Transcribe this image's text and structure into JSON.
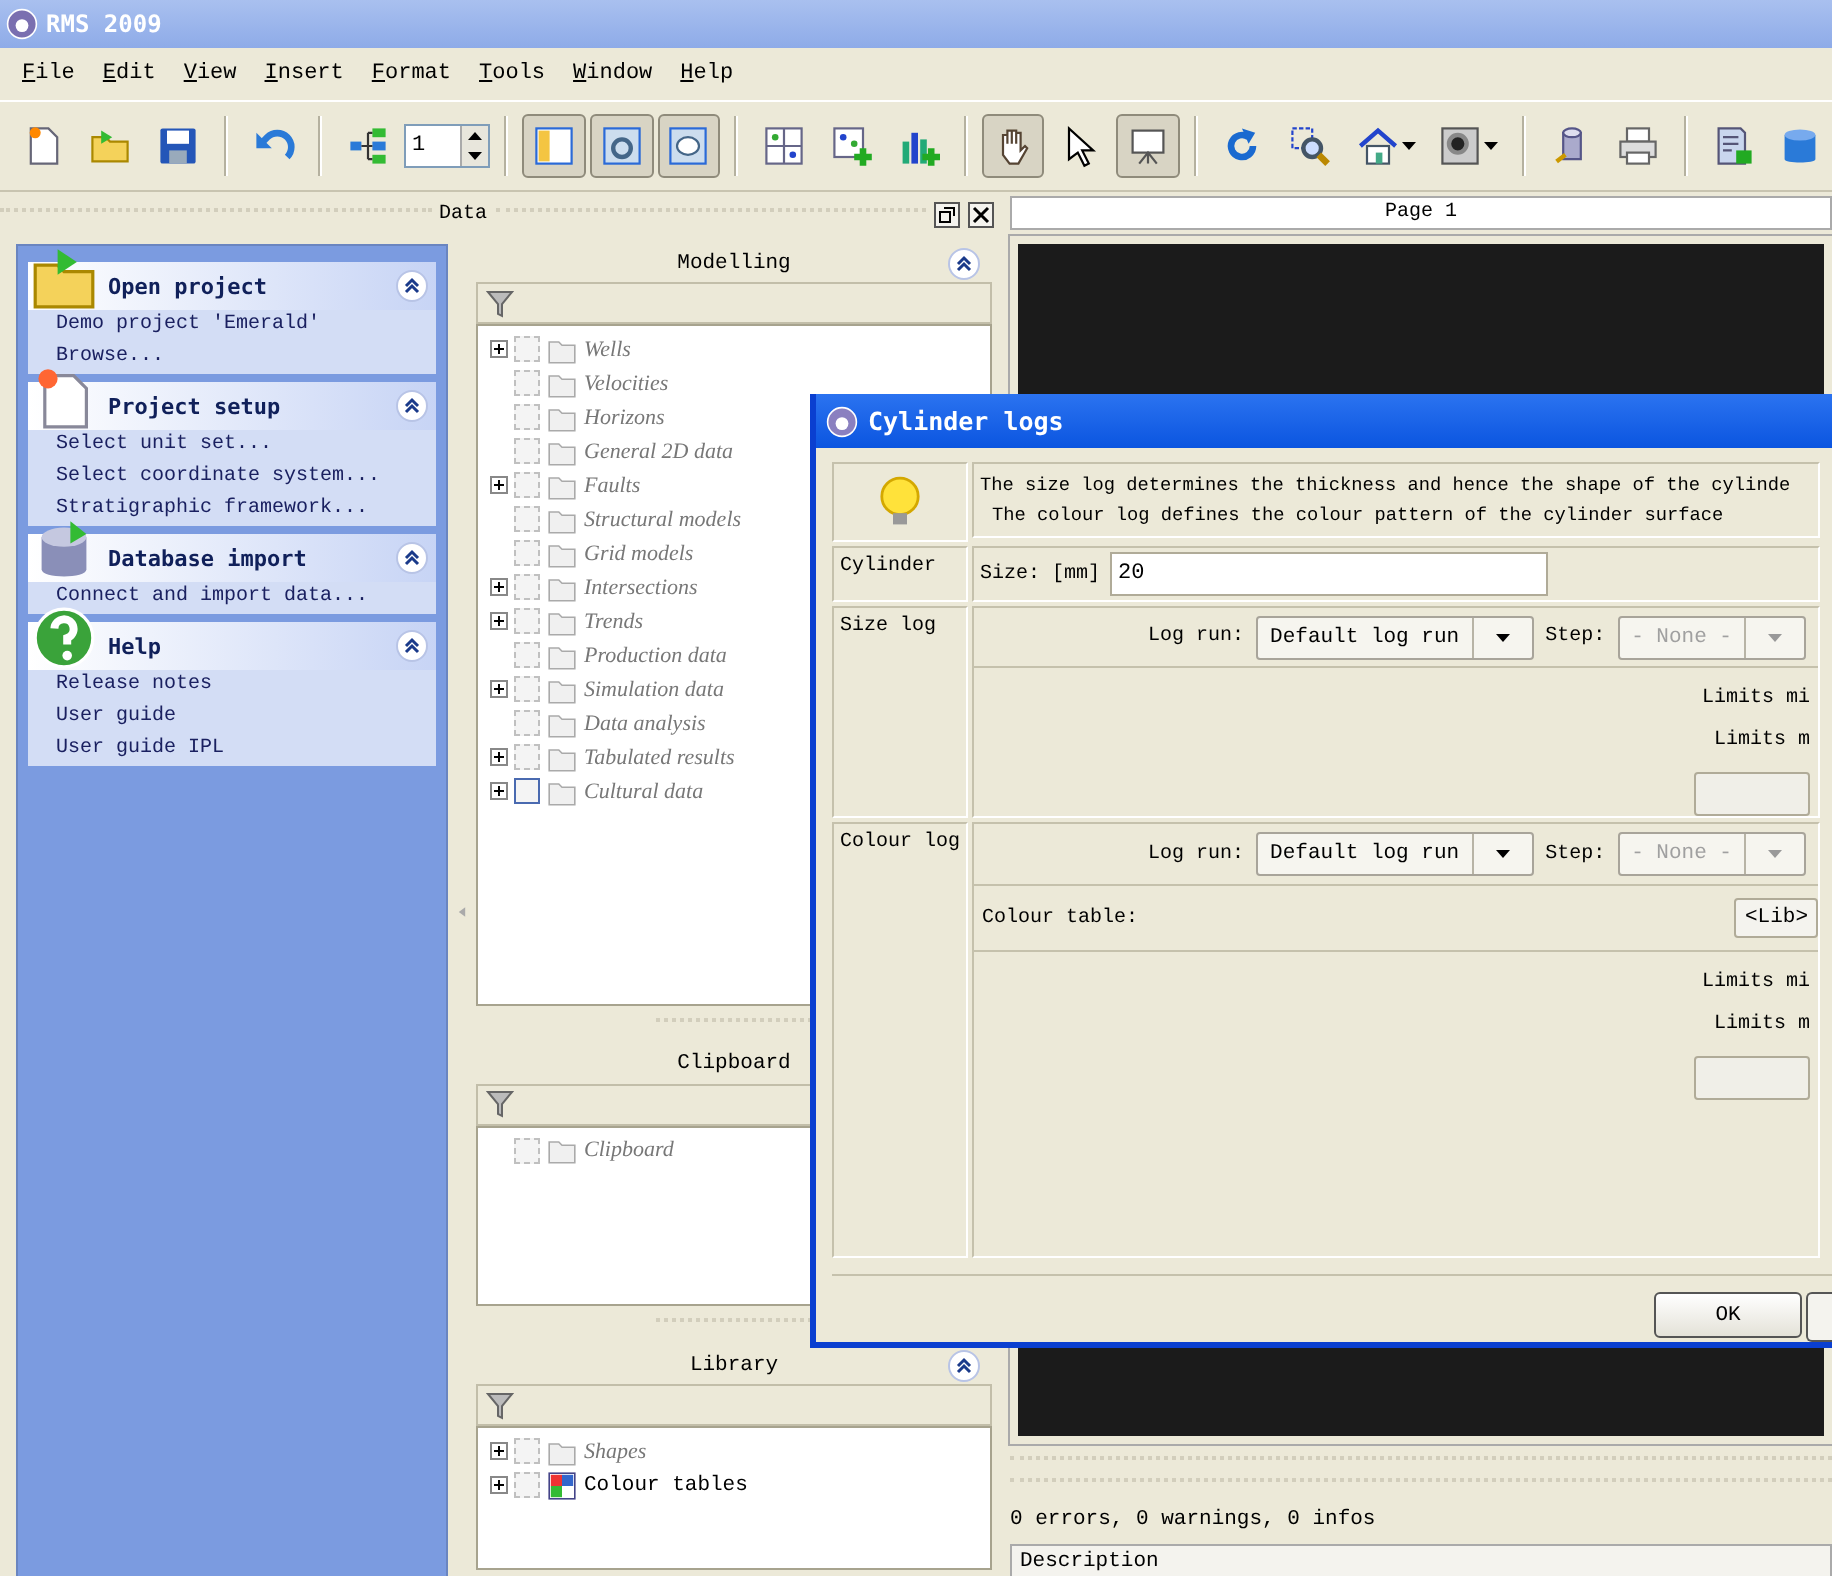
{
  "window": {
    "title": "RMS 2009"
  },
  "menu": [
    "File",
    "Edit",
    "View",
    "Insert",
    "Format",
    "Tools",
    "Window",
    "Help"
  ],
  "toolbar": [
    {
      "kind": "button",
      "pressed": false
    },
    {
      "kind": "button",
      "pressed": false
    },
    {
      "kind": "button",
      "pressed": false
    },
    {
      "kind": "separator"
    },
    {
      "kind": "button",
      "pressed": false
    },
    {
      "kind": "separator"
    },
    {
      "kind": "button",
      "pressed": false
    },
    {
      "kind": "spin",
      "value": "1"
    },
    {
      "kind": "separator"
    },
    {
      "kind": "button",
      "pressed": true
    },
    {
      "kind": "button",
      "pressed": true
    },
    {
      "kind": "button",
      "pressed": true
    },
    {
      "kind": "separator"
    },
    {
      "kind": "button",
      "pressed": false
    },
    {
      "kind": "button",
      "pressed": false
    },
    {
      "kind": "button",
      "pressed": false
    },
    {
      "kind": "separator"
    },
    {
      "kind": "button",
      "pressed": true
    },
    {
      "kind": "button",
      "pressed": false
    },
    {
      "kind": "button",
      "pressed": true
    },
    {
      "kind": "separator"
    },
    {
      "kind": "button",
      "pressed": false
    },
    {
      "kind": "button",
      "pressed": false
    },
    {
      "kind": "split",
      "pressed": false
    },
    {
      "kind": "split",
      "pressed": false
    },
    {
      "kind": "separator"
    },
    {
      "kind": "button",
      "pressed": false
    },
    {
      "kind": "button",
      "pressed": false
    },
    {
      "kind": "separator"
    },
    {
      "kind": "button",
      "pressed": false
    },
    {
      "kind": "button",
      "pressed": false
    }
  ],
  "data_pane": {
    "title": "Data"
  },
  "tasks": [
    {
      "title": "Open project",
      "items": [
        "Demo project 'Emerald'",
        "Browse..."
      ]
    },
    {
      "title": "Project setup",
      "items": [
        "Select unit set...",
        "Select coordinate system...",
        "Stratigraphic framework..."
      ]
    },
    {
      "title": "Database import",
      "items": [
        "Connect and import data..."
      ]
    },
    {
      "title": "Help",
      "items": [
        "Release notes",
        "User guide",
        "User guide IPL"
      ]
    }
  ],
  "sections": [
    {
      "title": "Modelling",
      "collapse_button": true,
      "items": [
        {
          "label": "Wells",
          "expandable": true,
          "dimmed": true,
          "checked": false,
          "checkbox_disabled": true
        },
        {
          "label": "Velocities",
          "expandable": false,
          "dimmed": true,
          "checked": false,
          "checkbox_disabled": true
        },
        {
          "label": "Horizons",
          "expandable": false,
          "dimmed": true,
          "checked": false,
          "checkbox_disabled": true
        },
        {
          "label": "General 2D data",
          "expandable": false,
          "dimmed": true,
          "checked": false,
          "checkbox_disabled": true
        },
        {
          "label": "Faults",
          "expandable": true,
          "dimmed": true,
          "checked": false,
          "checkbox_disabled": true
        },
        {
          "label": "Structural models",
          "expandable": false,
          "dimmed": true,
          "checked": false,
          "checkbox_disabled": true
        },
        {
          "label": "Grid models",
          "expandable": false,
          "dimmed": true,
          "checked": false,
          "checkbox_disabled": true
        },
        {
          "label": "Intersections",
          "expandable": true,
          "dimmed": true,
          "checked": false,
          "checkbox_disabled": true
        },
        {
          "label": "Trends",
          "expandable": true,
          "dimmed": true,
          "checked": false,
          "checkbox_disabled": true
        },
        {
          "label": "Production data",
          "expandable": false,
          "dimmed": true,
          "checked": false,
          "checkbox_disabled": true
        },
        {
          "label": "Simulation data",
          "expandable": true,
          "dimmed": true,
          "checked": false,
          "checkbox_disabled": true
        },
        {
          "label": "Data analysis",
          "expandable": false,
          "dimmed": true,
          "checked": false,
          "checkbox_disabled": true
        },
        {
          "label": "Tabulated results",
          "expandable": true,
          "dimmed": true,
          "checked": false,
          "checkbox_disabled": true
        },
        {
          "label": "Cultural data",
          "expandable": true,
          "dimmed": true,
          "checked": false,
          "checkbox_disabled": false
        }
      ]
    },
    {
      "title": "Clipboard",
      "collapse_button": false,
      "items": [
        {
          "label": "Clipboard",
          "expandable": false,
          "dimmed": true,
          "checked": false,
          "checkbox_disabled": true
        }
      ]
    },
    {
      "title": "Library",
      "collapse_button": true,
      "items": [
        {
          "label": "Shapes",
          "expandable": true,
          "dimmed": true,
          "checked": false,
          "checkbox_disabled": true
        },
        {
          "label": "Colour tables",
          "expandable": true,
          "dimmed": false,
          "checked": false,
          "checkbox_disabled": true
        }
      ]
    }
  ],
  "view": {
    "tab": "Page 1",
    "messages": "0 errors, 0 warnings, 0 infos",
    "column": "Description"
  },
  "dialog": {
    "title": "Cylinder logs",
    "info": [
      "The size log determines the thickness and hence the shape of the cylinde",
      "The colour log defines the colour pattern of the cylinder surface"
    ],
    "cylinder": {
      "label": "Cylinder",
      "size_label": "Size: [mm]",
      "size_value": "20"
    },
    "logs": [
      {
        "label": "Size log",
        "log_run_label": "Log run:",
        "log_run": "Default log run",
        "step_label": "Step:",
        "step": "- None -",
        "step_disabled": true,
        "limits_min_label": "Limits mi",
        "limits_max_label": "Limits m"
      },
      {
        "label": "Colour log",
        "log_run_label": "Log run:",
        "log_run": "Default log run",
        "step_label": "Step:",
        "step": "- None -",
        "step_disabled": true,
        "colour_table_label": "Colour table:",
        "lib_button": "<Lib>",
        "limits_min_label": "Limits mi",
        "limits_max_label": "Limits m"
      }
    ],
    "ok_button": "OK"
  }
}
